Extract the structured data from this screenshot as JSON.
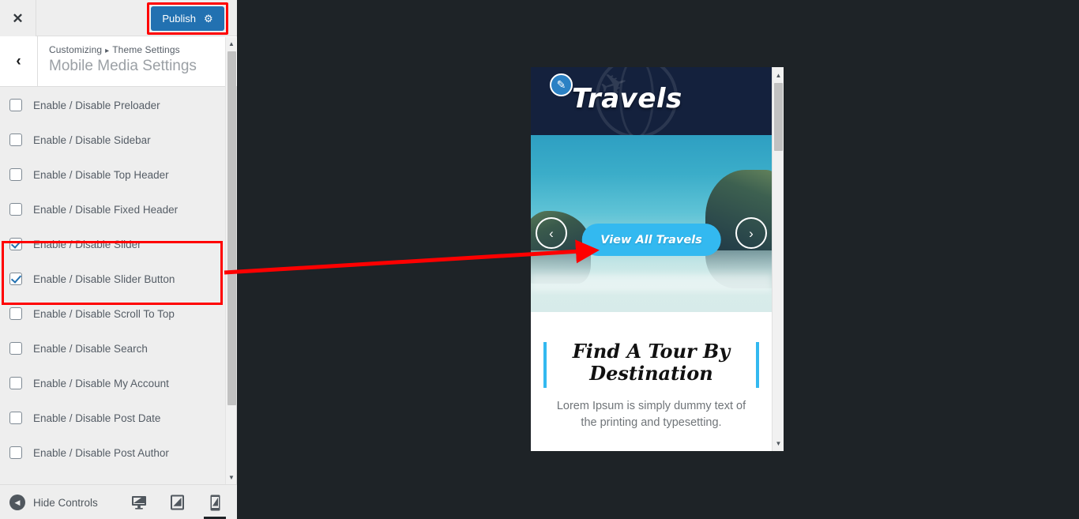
{
  "header": {
    "close_label": "✕",
    "publish_label": "Publish",
    "gear_icon": "⚙",
    "accent_color": "#2271b1",
    "annotation_color": "#ff0000"
  },
  "panel": {
    "back_icon": "‹",
    "breadcrumb_root": "Customizing",
    "breadcrumb_sep": "▸",
    "breadcrumb_parent": "Theme Settings",
    "title": "Mobile Media Settings"
  },
  "controls": [
    {
      "label": "Enable / Disable Preloader",
      "checked": false
    },
    {
      "label": "Enable / Disable Sidebar",
      "checked": false
    },
    {
      "label": "Enable / Disable Top Header",
      "checked": false
    },
    {
      "label": "Enable / Disable Fixed Header",
      "checked": false
    },
    {
      "label": "Enable / Disable Slider",
      "checked": true
    },
    {
      "label": "Enable / Disable Slider Button",
      "checked": true
    },
    {
      "label": "Enable / Disable Scroll To Top",
      "checked": false
    },
    {
      "label": "Enable / Disable Search",
      "checked": false
    },
    {
      "label": "Enable / Disable My Account",
      "checked": false
    },
    {
      "label": "Enable / Disable Post Date",
      "checked": false
    },
    {
      "label": "Enable / Disable Post Author",
      "checked": false
    }
  ],
  "footer": {
    "hide_controls_label": "Hide Controls",
    "collapse_icon": "◀",
    "devices": [
      {
        "name": "desktop",
        "active": false
      },
      {
        "name": "tablet",
        "active": false
      },
      {
        "name": "mobile",
        "active": true
      }
    ]
  },
  "scrollbars": {
    "up_arrow": "▲",
    "down_arrow": "▼"
  },
  "preview": {
    "site_title": "Travels",
    "edit_icon": "✎",
    "plane_icon": "✈",
    "slider": {
      "button_label": "View All Travels",
      "prev_icon": "‹",
      "next_icon": "›",
      "button_color": "#33b9f0"
    },
    "tour": {
      "title_line1": "Find A Tour By",
      "title_line2": "Destination",
      "description": "Lorem Ipsum is simply dummy text of the printing and typesetting."
    }
  }
}
